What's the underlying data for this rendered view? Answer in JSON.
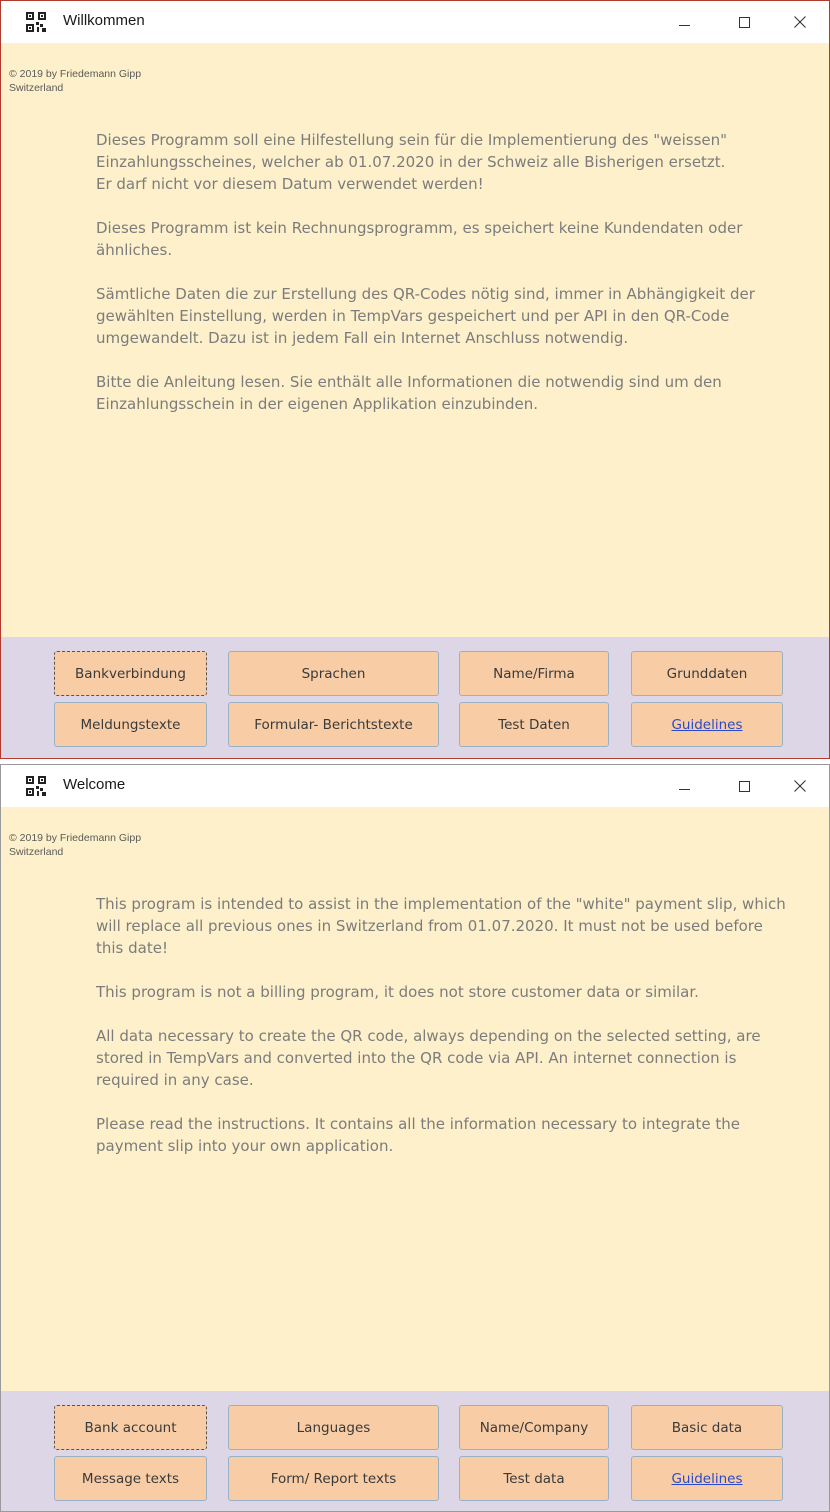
{
  "colors": {
    "background": "#fef0ca",
    "button_bar": "#dcd6e6",
    "button": "#f8cda6",
    "link": "#2b49c9"
  },
  "windows": [
    {
      "title": "Willkommen",
      "icon": "qr-app-icon",
      "copyright_line1": "© 2019 by Friedemann Gipp",
      "copyright_line2": "Switzerland",
      "paragraphs": [
        "Dieses Programm soll eine Hilfestellung sein für die Implementierung des \"weissen\" Einzahlungsscheines, welcher ab 01.07.2020 in der Schweiz alle Bisherigen ersetzt.\nEr darf nicht vor diesem Datum verwendet werden!",
        "Dieses Programm ist kein Rechnungsprogramm, es speichert keine Kundendaten oder ähnliches.",
        "Sämtliche Daten die zur Erstellung des QR-Codes nötig sind, immer in Abhängigkeit der gewählten Einstellung, werden in TempVars gespeichert und per API in den QR-Code umgewandelt. Dazu ist in jedem Fall ein Internet Anschluss notwendig.",
        "Bitte die Anleitung lesen. Sie enthält alle Informationen die notwendig sind um den Einzahlungsschein in der eigenen Applikation einzubinden."
      ],
      "buttons": {
        "bank": "Bankverbindung",
        "languages": "Sprachen",
        "name": "Name/Firma",
        "basic": "Grunddaten",
        "messages": "Meldungstexte",
        "form": "Formular- Berichtstexte",
        "test": "Test Daten",
        "guidelines": "Guidelines"
      }
    },
    {
      "title": "Welcome",
      "icon": "qr-app-icon",
      "copyright_line1": "© 2019 by Friedemann Gipp",
      "copyright_line2": "Switzerland",
      "paragraphs": [
        "This program is intended to assist in the implementation of the \"white\" payment slip, which will replace all previous ones in Switzerland from 01.07.2020. It must not be used before this date!",
        "This program is not a billing program, it does not store customer data or similar.",
        "All data necessary to create the QR code, always depending on the selected setting, are stored in TempVars and converted into the QR code via API. An internet connection is required in any case.",
        "Please read the instructions. It contains all the information necessary to integrate the payment slip into your own application."
      ],
      "buttons": {
        "bank": "Bank account",
        "languages": "Languages",
        "name": "Name/Company",
        "basic": "Basic data",
        "messages": "Message texts",
        "form": "Form/ Report texts",
        "test": "Test data",
        "guidelines": "Guidelines"
      }
    }
  ]
}
